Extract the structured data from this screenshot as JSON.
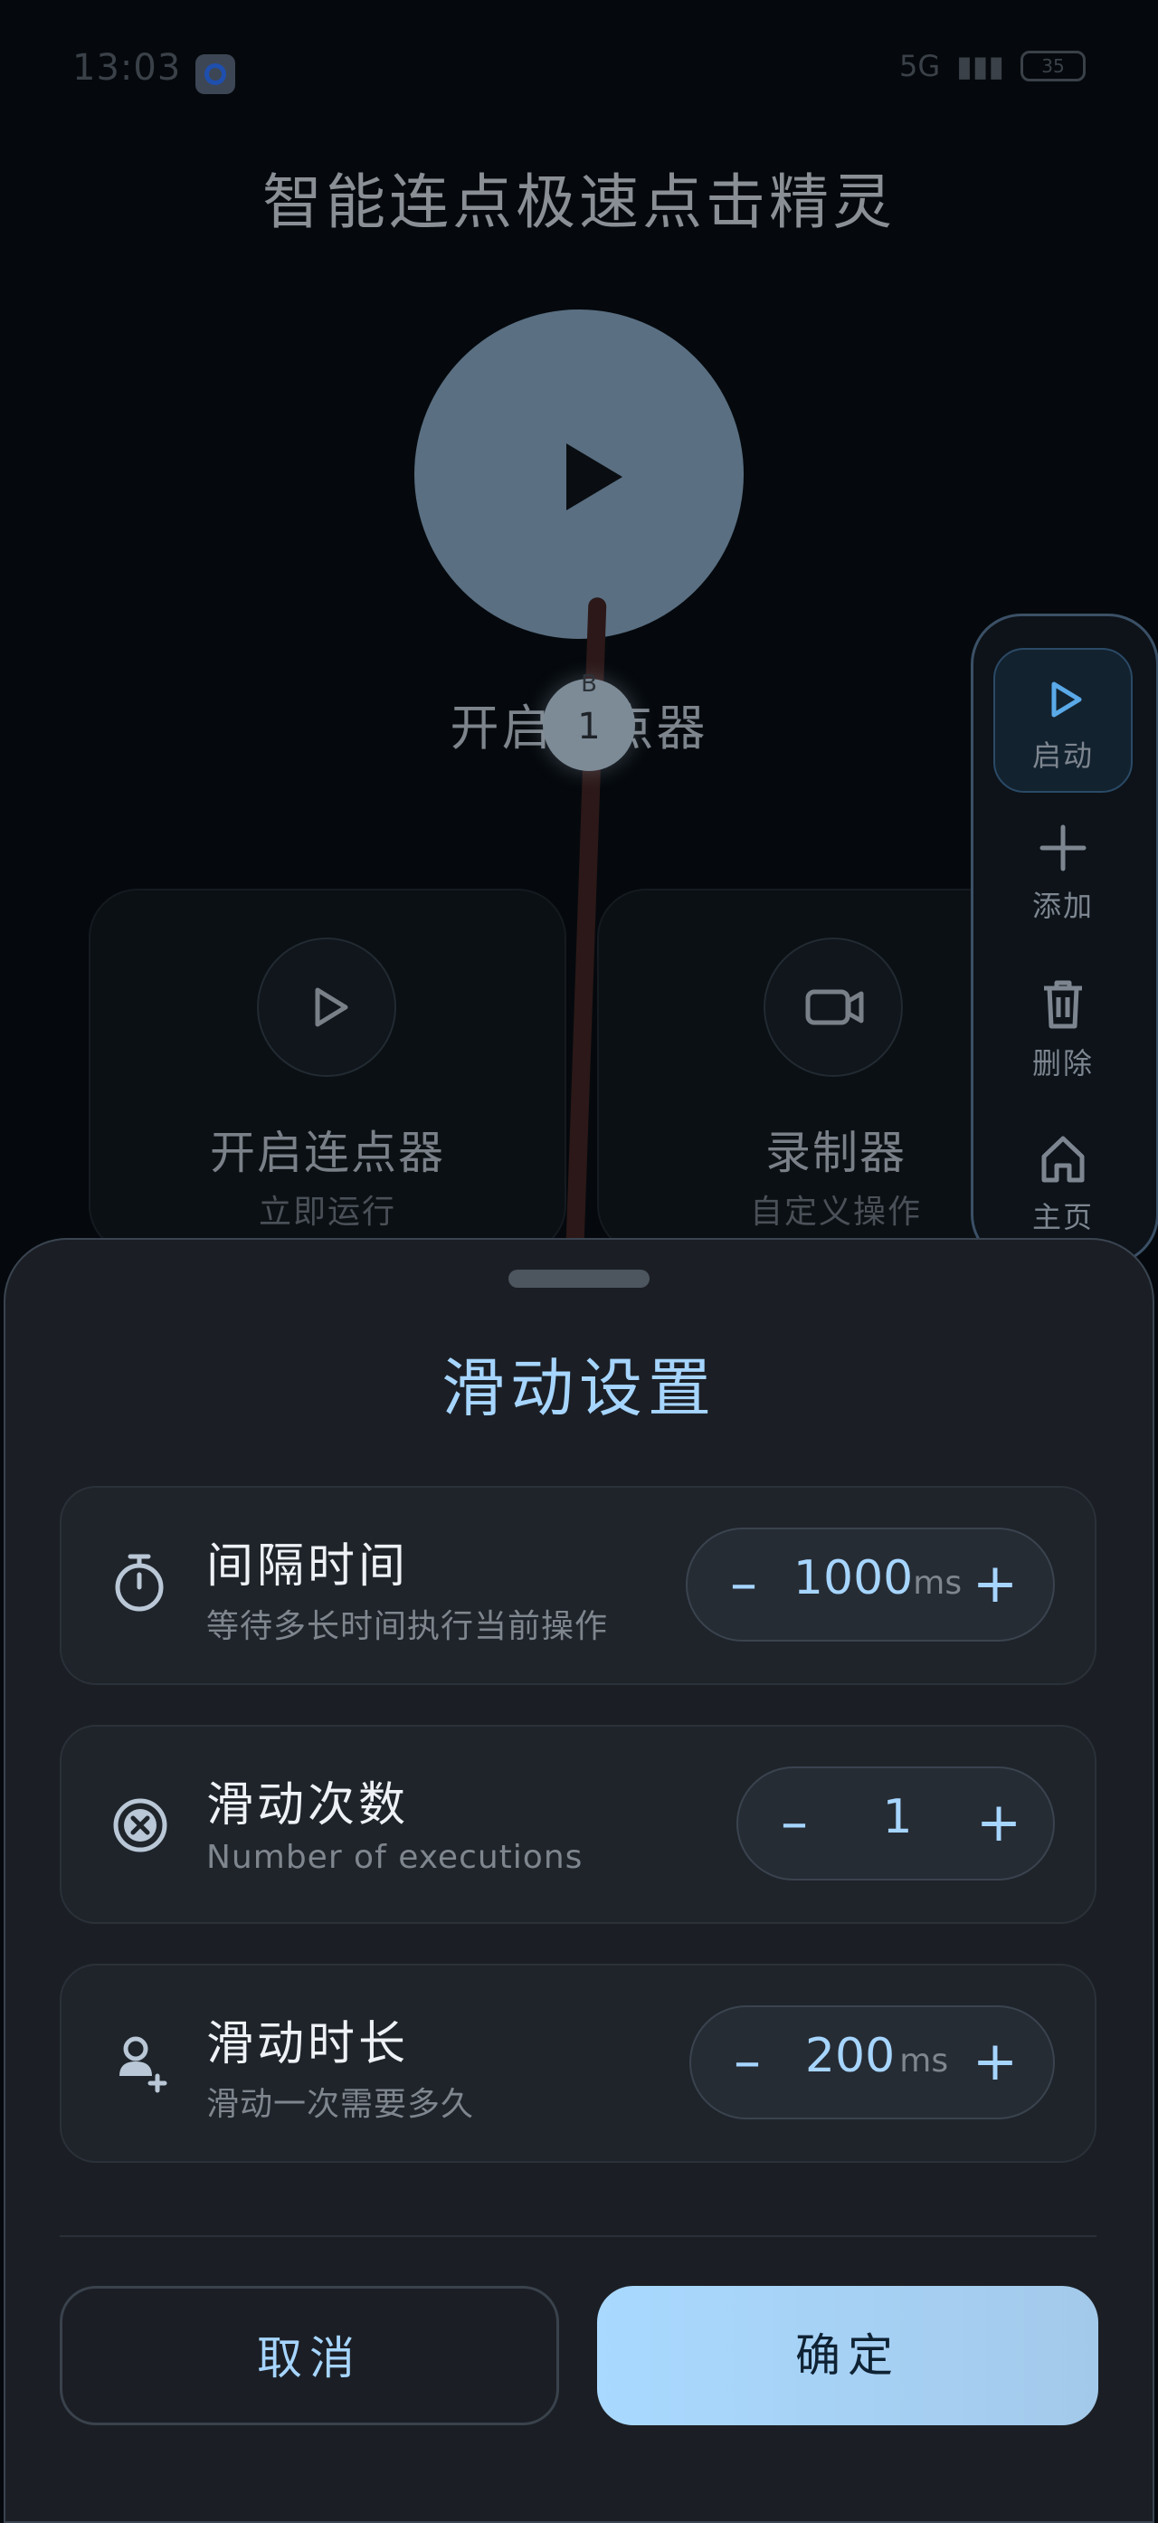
{
  "status_bar": {
    "time": "13:03",
    "network": "5G",
    "battery": "35"
  },
  "app": {
    "title": "智能连点极速点击精灵"
  },
  "hero": {
    "label": "开启连点器"
  },
  "swipe_point": {
    "letter": "B",
    "number": "1"
  },
  "cards": [
    {
      "title": "开启连点器",
      "subtitle": "立即运行",
      "icon": "play-icon"
    },
    {
      "title": "录制器",
      "subtitle": "自定义操作",
      "icon": "video-camera-icon"
    }
  ],
  "toolbar": [
    {
      "label": "启动",
      "icon": "play-icon"
    },
    {
      "label": "添加",
      "icon": "plus-icon"
    },
    {
      "label": "删除",
      "icon": "trash-icon"
    },
    {
      "label": "主页",
      "icon": "home-icon"
    }
  ],
  "sheet": {
    "title": "滑动设置",
    "rows": [
      {
        "title": "间隔时间",
        "subtitle": "等待多长时间执行当前操作",
        "value": "1000",
        "unit": "ms",
        "icon": "stopwatch-icon"
      },
      {
        "title": "滑动次数",
        "subtitle": "Number of executions",
        "value": "1",
        "unit": "",
        "icon": "cancel-circle-icon"
      },
      {
        "title": "滑动时长",
        "subtitle": "滑动一次需要多久",
        "value": "200",
        "unit": "ms",
        "icon": "user-add-icon"
      }
    ],
    "minus_glyph": "–",
    "plus_glyph": "+",
    "cancel_label": "取消",
    "confirm_label": "确定"
  },
  "colors": {
    "accent": "#a6d5ff",
    "sheet_bg": "#1b1f25",
    "page_bg": "#05090d"
  }
}
